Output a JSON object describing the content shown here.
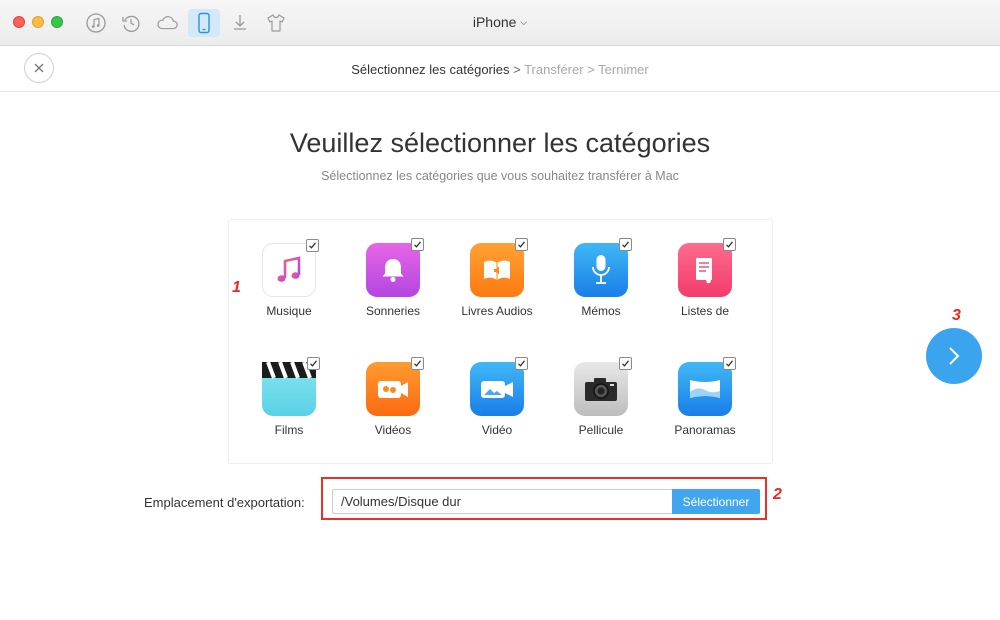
{
  "window": {
    "device_title": "iPhone",
    "traffic_lights": [
      "#fc605b",
      "#fdbc40",
      "#34c84a"
    ],
    "toolbar_icons": [
      "itunes-icon",
      "restore-icon",
      "icloud-icon",
      "phone-icon",
      "download-icon",
      "tshirt-icon"
    ]
  },
  "breadcrumb": {
    "current": "Sélectionnez les catégories",
    "sep1": " > ",
    "step2": "Transférer",
    "sep2": " > ",
    "step3": "Ternimer"
  },
  "heading": "Veuillez sélectionner les catégories",
  "subheading": "Sélectionnez les catégories que vous souhaitez transférer à Mac",
  "categories": [
    {
      "label": "Musique",
      "checked": true
    },
    {
      "label": "Sonneries",
      "checked": true
    },
    {
      "label": "Livres Audios",
      "checked": true
    },
    {
      "label": "Mémos",
      "checked": true
    },
    {
      "label": "Listes de",
      "checked": true
    },
    {
      "label": "Films",
      "checked": true
    },
    {
      "label": "Vidéos",
      "checked": true
    },
    {
      "label": "Vidéo",
      "checked": true
    },
    {
      "label": "Pellicule",
      "checked": true
    },
    {
      "label": "Panoramas",
      "checked": true
    }
  ],
  "export": {
    "label": "Emplacement d'exportation:",
    "path": "/Volumes/Disque dur",
    "button": "Sélectionner"
  },
  "markers": {
    "one": "1",
    "two": "2",
    "three": "3"
  },
  "colors": {
    "accent": "#3aa4ee",
    "highlight": "#e8312a"
  }
}
